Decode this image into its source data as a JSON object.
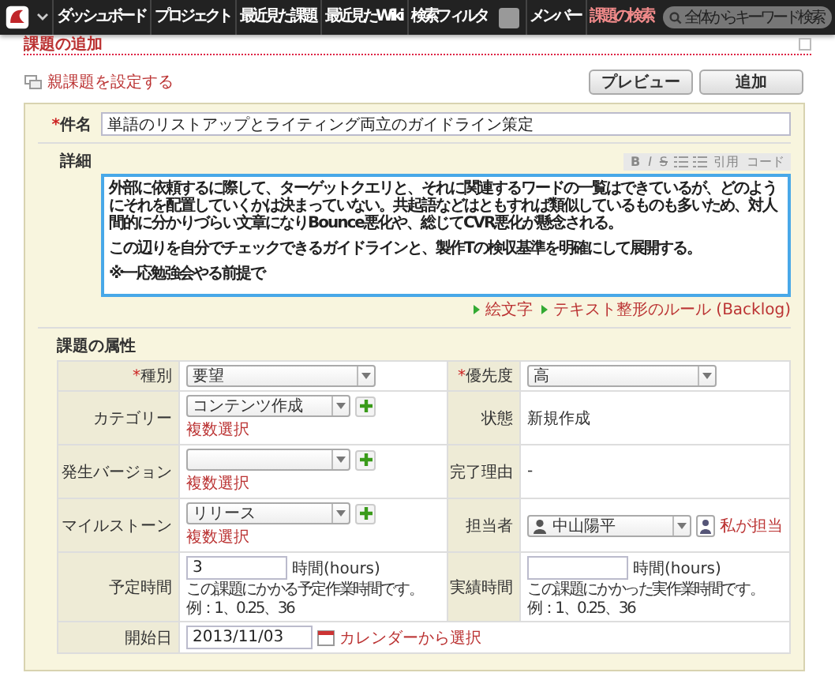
{
  "nav": {
    "items": [
      {
        "label": "ダッシュボード",
        "selected": false
      },
      {
        "label": "プロジェクト",
        "selected": false
      },
      {
        "label": "最近見た課題",
        "selected": false
      },
      {
        "label": "最近見たWiki",
        "selected": false
      },
      {
        "label": "検索フィルタ",
        "selected": false
      },
      {
        "label": "メンバー",
        "selected": false
      },
      {
        "label": "課題の検索",
        "selected": true
      }
    ],
    "search": {
      "placeholder": "全体からキーワード検索"
    }
  },
  "page_title": "課題の追加",
  "parent_link": "親課題を設定する",
  "buttons": [
    "プレビュー",
    "追加"
  ],
  "subject": {
    "label": "件名",
    "required_mark": "*",
    "value": "単語のリストアップとライティング両立のガイドライン策定"
  },
  "detail": {
    "label": "詳細",
    "toolbar": [
      {
        "kind": "bold",
        "label": "B"
      },
      {
        "kind": "italic",
        "label": "I"
      },
      {
        "kind": "strike",
        "label": "S"
      },
      {
        "kind": "bullet-list"
      },
      {
        "kind": "number-list"
      },
      {
        "kind": "text",
        "label": "引用"
      },
      {
        "kind": "text",
        "label": "コード"
      }
    ],
    "paragraphs": [
      "外部に依頼するに際して、ターゲットクエリと、それに関連するワードの一覧はできているが、どのようにそれを配置していくかは決まっていない。共起語などはともすれば類似しているものも多いため、対人間的に分かりづらい文章になりBounce悪化や、総じてCVR悪化が懸念される。",
      "この辺りを自分でチェックできるガイドラインと、製作Tの検収基準を明確にして展開する。",
      "※一応勉強会やる前提で"
    ],
    "links": [
      "絵文字",
      "テキスト整形のルール (Backlog)"
    ]
  },
  "attributes": {
    "title": "課題の属性",
    "rows": [
      {
        "cells": [
          {
            "label": "種別",
            "required_mark": "*",
            "kind": "select",
            "value": "要望"
          },
          {
            "label": "優先度",
            "required_mark": "*",
            "kind": "select",
            "value": "高"
          }
        ]
      },
      {
        "cells": [
          {
            "label": "カテゴリー",
            "kind": "select",
            "value": "コンテンツ作成",
            "add": true,
            "multi_link": "複数選択"
          },
          {
            "label": "状態",
            "kind": "text",
            "value": "新規作成"
          }
        ]
      },
      {
        "cells": [
          {
            "label": "発生バージョン",
            "kind": "select",
            "add": true,
            "multi_link": "複数選択"
          },
          {
            "label": "完了理由",
            "kind": "text",
            "value": "-"
          }
        ]
      },
      {
        "cells": [
          {
            "label": "マイルストーン",
            "kind": "select",
            "value": "リリース",
            "add": true,
            "multi_link": "複数選択"
          },
          {
            "label": "担当者",
            "kind": "user-select",
            "value": "中山陽平",
            "self_link": "私が担当"
          }
        ]
      },
      {
        "cells": [
          {
            "label": "予定時間",
            "kind": "hours",
            "value": "3",
            "unit": "時間(hours)",
            "hint": [
              "この課題にかかる予定作業時間です。",
              "例：1、0.25、36"
            ]
          },
          {
            "label": "実績時間",
            "kind": "hours",
            "unit": "時間(hours)",
            "hint": [
              "この課題にかかった実作業時間です。",
              "例：1、0.25、36"
            ]
          }
        ]
      },
      {
        "cells": [
          {
            "label": "開始日",
            "kind": "date",
            "value": "2013/11/03",
            "calendar_link": "カレンダーから選択"
          }
        ]
      }
    ]
  }
}
